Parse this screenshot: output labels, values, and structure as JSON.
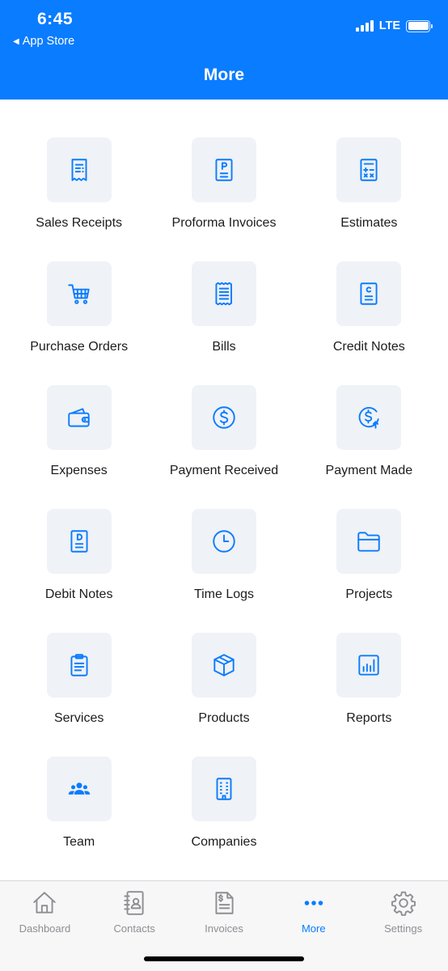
{
  "status_bar": {
    "time": "6:45",
    "back_label": "App Store",
    "network": "LTE"
  },
  "header": {
    "title": "More"
  },
  "menu": [
    {
      "id": "sales-receipts",
      "label": "Sales Receipts",
      "icon": "receipt-icon"
    },
    {
      "id": "proforma-invoices",
      "label": "Proforma Invoices",
      "icon": "proforma-doc-icon"
    },
    {
      "id": "estimates",
      "label": "Estimates",
      "icon": "calculator-icon"
    },
    {
      "id": "purchase-orders",
      "label": "Purchase Orders",
      "icon": "cart-icon"
    },
    {
      "id": "bills",
      "label": "Bills",
      "icon": "bill-icon"
    },
    {
      "id": "credit-notes",
      "label": "Credit Notes",
      "icon": "credit-note-icon"
    },
    {
      "id": "expenses",
      "label": "Expenses",
      "icon": "wallet-icon"
    },
    {
      "id": "payment-received",
      "label": "Payment Received",
      "icon": "dollar-circle-icon"
    },
    {
      "id": "payment-made",
      "label": "Payment Made",
      "icon": "dollar-out-icon"
    },
    {
      "id": "debit-notes",
      "label": "Debit Notes",
      "icon": "debit-note-icon"
    },
    {
      "id": "time-logs",
      "label": "Time Logs",
      "icon": "clock-icon"
    },
    {
      "id": "projects",
      "label": "Projects",
      "icon": "folder-icon"
    },
    {
      "id": "services",
      "label": "Services",
      "icon": "clipboard-icon"
    },
    {
      "id": "products",
      "label": "Products",
      "icon": "box-icon"
    },
    {
      "id": "reports",
      "label": "Reports",
      "icon": "bar-chart-icon"
    },
    {
      "id": "team",
      "label": "Team",
      "icon": "team-icon"
    },
    {
      "id": "companies",
      "label": "Companies",
      "icon": "building-icon"
    }
  ],
  "tabbar": {
    "tabs": [
      {
        "id": "dashboard",
        "label": "Dashboard",
        "icon": "home-icon"
      },
      {
        "id": "contacts",
        "label": "Contacts",
        "icon": "contacts-book-icon"
      },
      {
        "id": "invoices",
        "label": "Invoices",
        "icon": "invoice-icon"
      },
      {
        "id": "more",
        "label": "More",
        "icon": "more-dots-icon"
      },
      {
        "id": "settings",
        "label": "Settings",
        "icon": "gear-icon"
      }
    ],
    "active": "more"
  },
  "colors": {
    "brand": "#0a7cff",
    "tile_bg": "#eff2f6",
    "inactive": "#8e8e93"
  }
}
